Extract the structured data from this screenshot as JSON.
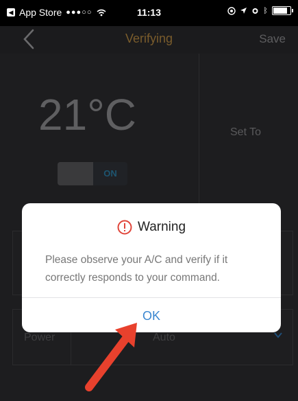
{
  "status_bar": {
    "back_app": "App Store",
    "signal": "●●●○○",
    "time": "11:13",
    "icons": [
      "location-icon",
      "alarm-icon",
      "bluetooth-icon",
      "battery-icon"
    ]
  },
  "nav": {
    "title": "Verifying",
    "save_label": "Save"
  },
  "main": {
    "temperature": "21°C",
    "set_to_label": "Set To",
    "toggle_label": "ON",
    "power_label": "Power",
    "mode_value": "Auto"
  },
  "dialog": {
    "title": "Warning",
    "message": "Please observe your A/C and verify if it correctly responds to your command.",
    "ok_label": "OK"
  },
  "colors": {
    "accent_title": "#7a5c2c",
    "ok_blue": "#3a86d0",
    "warning_red": "#e0453a",
    "arrow_red": "#e8412d"
  }
}
